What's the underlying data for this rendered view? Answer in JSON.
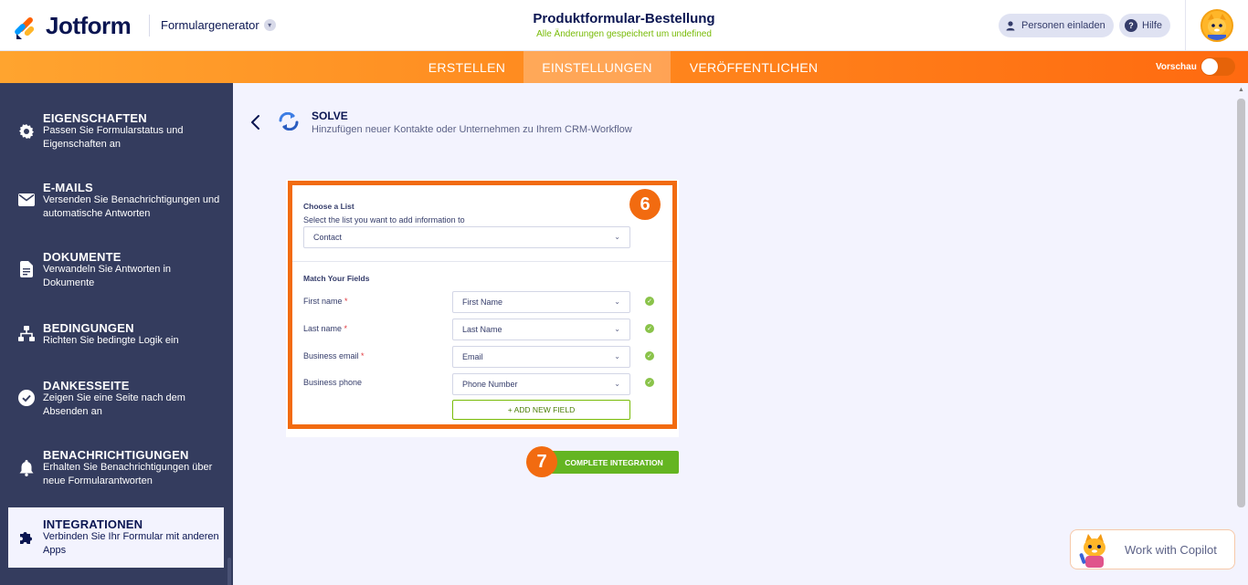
{
  "header": {
    "brand": "Jotform",
    "builder_menu": "Formulargenerator",
    "form_title": "Produktformular-Bestellung",
    "save_status": "Alle Änderungen gespeichert um undefined",
    "invite_label": "Personen einladen",
    "help_label": "Hilfe"
  },
  "tabs": {
    "create": "ERSTELLEN",
    "settings": "EINSTELLUNGEN",
    "publish": "VERÖFFENTLICHEN",
    "active": "EINSTELLUNGEN"
  },
  "preview": {
    "label": "Vorschau",
    "enabled": false
  },
  "sidebar": {
    "items": [
      {
        "title": "EIGENSCHAFTEN",
        "desc": "Passen Sie Formularstatus und Eigenschaften an",
        "icon": "gear-icon"
      },
      {
        "title": "E-MAILS",
        "desc": "Versenden Sie Benachrichtigungen und automatische Antworten",
        "icon": "envelope-icon"
      },
      {
        "title": "DOKUMENTE",
        "desc": "Verwandeln Sie Antworten in Dokumente",
        "icon": "document-icon"
      },
      {
        "title": "BEDINGUNGEN",
        "desc": "Richten Sie bedingte Logik ein",
        "icon": "hierarchy-icon"
      },
      {
        "title": "DANKESSEITE",
        "desc": "Zeigen Sie eine Seite nach dem Absenden an",
        "icon": "check-circle-icon"
      },
      {
        "title": "BENACHRICHTIGUNGEN",
        "desc": "Erhalten Sie Benachrichtigungen über neue Formularantworten",
        "icon": "bell-icon"
      },
      {
        "title": "INTEGRATIONEN",
        "desc": "Verbinden Sie Ihr Formular mit anderen Apps",
        "icon": "puzzle-icon",
        "active": true
      }
    ]
  },
  "integration": {
    "name": "SOLVE",
    "description": "Hinzufügen neuer Kontakte oder Unternehmen zu Ihrem CRM-Workflow",
    "choose_list_title": "Choose a List",
    "choose_list_hint": "Select the list you want to add information to",
    "list_value": "Contact",
    "match_title": "Match Your Fields",
    "fields": [
      {
        "label": "First name",
        "required": true,
        "value": "First Name"
      },
      {
        "label": "Last name",
        "required": true,
        "value": "Last Name"
      },
      {
        "label": "Business email",
        "required": true,
        "value": "Email"
      },
      {
        "label": "Business phone",
        "required": false,
        "value": "Phone Number"
      }
    ],
    "required_mark": "*",
    "add_field_label": "+ ADD NEW FIELD",
    "complete_label": "COMPLETE INTEGRATION",
    "step_badge_1": "6",
    "step_badge_2": "7"
  },
  "copilot": {
    "label": "Work with Copilot"
  },
  "colors": {
    "accent_orange": "#f26b10",
    "sidebar_bg": "#343c5e",
    "success_green": "#64b522",
    "save_status_green": "#78bb07",
    "content_bg": "#f3f3fe"
  }
}
